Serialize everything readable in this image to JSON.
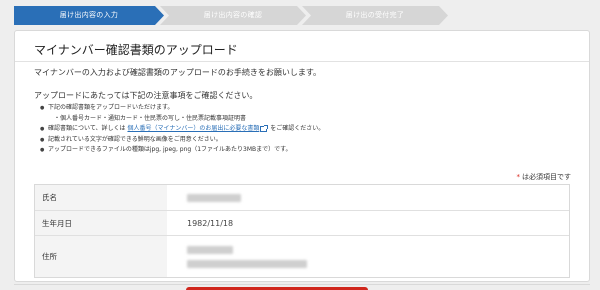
{
  "steps": [
    {
      "label": "届け出内容の入力",
      "active": true
    },
    {
      "label": "届け出内容の確認",
      "active": false
    },
    {
      "label": "届け出の受付完了",
      "active": false
    }
  ],
  "page": {
    "title": "マイナンバー確認書類のアップロード",
    "intro": "マイナンバーの入力および確認書類のアップロードのお手続きをお願いします。",
    "notes_heading": "アップロードにあたっては下記の注意事項をご確認ください。"
  },
  "notes": {
    "item1": "下記の確認書類をアップロードいただけます。",
    "item1_sub": "・個人番号カード・通知カード・住民票の写し・住民票記載事項証明書",
    "item2_prefix": "確認書類について、詳しくは",
    "item2_link": "個人番号（マイナンバー）のお届出に必要な書類",
    "item2_suffix": "をご確認ください。",
    "item3": "記載されている文字が確認できる鮮明な画像をご用意ください。",
    "item4": "アップロードできるファイルの種類はjpg, jpeg, png（1ファイルあたり3MBまで）です。"
  },
  "required_mark": "*",
  "required_text": "は必須項目です",
  "info": {
    "name_label": "氏名",
    "dob_label": "生年月日",
    "dob_value": "1982/11/18",
    "address_label": "住所"
  },
  "icons": {
    "external_link": "external-link-icon"
  },
  "colors": {
    "accent": "#2a6fb7",
    "required": "#d9261c",
    "cta": "#d0271d"
  }
}
